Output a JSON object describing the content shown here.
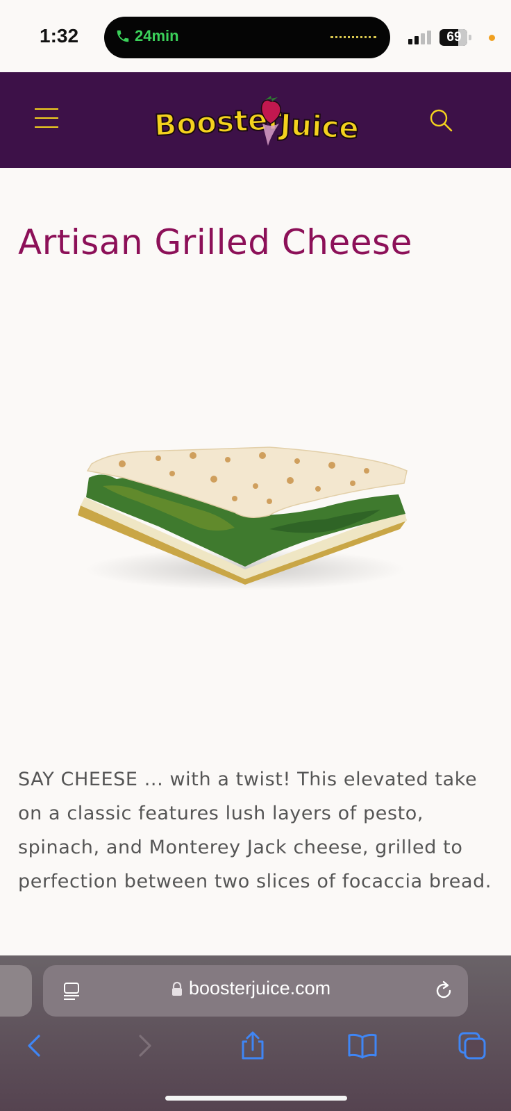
{
  "status_bar": {
    "time": "1:32",
    "call_duration": "24min",
    "battery": "69"
  },
  "header": {
    "logo_text": "Booster Juice",
    "colors": {
      "background": "#3d1148",
      "accent": "#f4d21e"
    }
  },
  "product": {
    "title": "Artisan Grilled Cheese",
    "description": "SAY CHEESE ... with a twist! This elevated take on a classic features lush layers of pesto, spinach, and Monterey Jack cheese, grilled to perfection between two slices of focaccia bread."
  },
  "browser": {
    "url": "boosterjuice.com",
    "icons": [
      "reader-icon",
      "lock-icon",
      "reload-icon",
      "back-icon",
      "forward-icon",
      "share-icon",
      "bookmarks-icon",
      "tabs-icon"
    ]
  }
}
